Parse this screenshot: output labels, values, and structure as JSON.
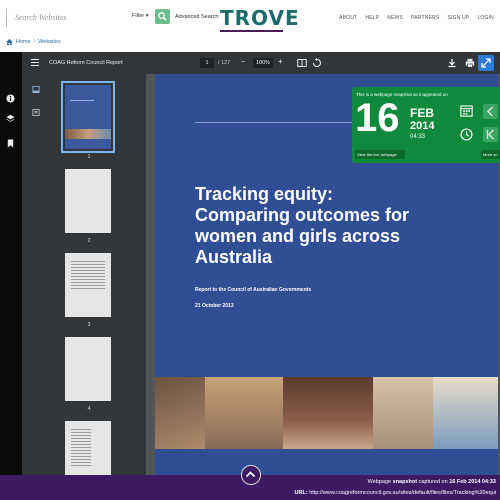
{
  "header": {
    "search_placeholder": "Search Websites",
    "filter_label": "Filter ▾",
    "advanced_label": "Advanced Search",
    "logo_text": "TROVE",
    "nav": [
      "ABOUT",
      "HELP",
      "NEWS",
      "PARTNERS",
      "SIGN UP",
      "LOGIN"
    ]
  },
  "breadcrumb": {
    "home": "Home",
    "sep": "/",
    "current": "Websites"
  },
  "toolbar": {
    "doc_title": "COAG Reform Council Report",
    "page_current": "1",
    "page_total": "/ 127",
    "zoom_minus": "−",
    "zoom": "100%",
    "zoom_plus": "+"
  },
  "thumbnails": [
    "1",
    "2",
    "3",
    "4"
  ],
  "document": {
    "heading": "Tracking equity: Comparing outcomes for women and girls across Australia",
    "subtitle": "Report to the Council of Australian Governments",
    "date": "21 October 2013"
  },
  "snapshot": {
    "intro": "This is a webpage snapshot as it appeared on",
    "day": "16",
    "month": "FEB",
    "year": "2014",
    "time": "04:33",
    "live_button": "View the live webpage",
    "more_button": "More sn"
  },
  "footer": {
    "line1_prefix": "Webpage ",
    "line1_bold": "snapshot",
    "line1_mid": " captured on ",
    "line1_date": "16 Feb 2014 04:33",
    "url_label": "URL:",
    "url": "http://www.coagreformcouncil.gov.au/sites/default/files/files/Tracking%20equi"
  },
  "colors": {
    "accent": "#6dbe8f",
    "snapshot": "#0f8a3c",
    "footer": "#3e1a63",
    "page": "#2f4e94",
    "logo": "#1a6d6a"
  }
}
